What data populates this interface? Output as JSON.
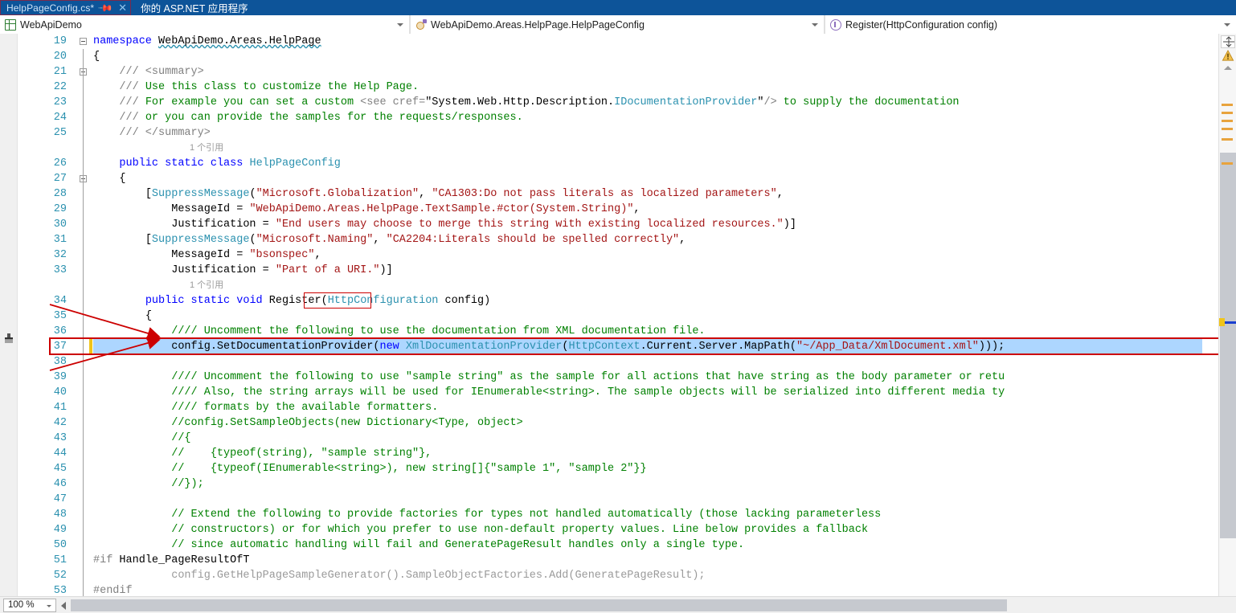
{
  "window": {
    "app_caption": "你的 ASP.NET 应用程序"
  },
  "tab": {
    "title": "HelpPageConfig.cs*",
    "pin_icon": "pin-icon",
    "close_icon": "close-icon"
  },
  "navbar": {
    "project": {
      "label": "WebApiDemo",
      "icon": "project-icon"
    },
    "type": {
      "label": "WebApiDemo.Areas.HelpPage.HelpPageConfig",
      "icon": "class-icon"
    },
    "member": {
      "label": "Register(HttpConfiguration config)",
      "icon": "method-icon"
    }
  },
  "editor": {
    "first_line": 19,
    "codelens_label": "1 个引用",
    "selected_line": 37,
    "lines": [
      {
        "n": 19,
        "html": "<span class=\"kw\">namespace</span> <span class=\"pln squiggle\">WebApiDemo.Areas.HelpPage</span>"
      },
      {
        "n": 20,
        "html": "<span class=\"pln\">{</span>"
      },
      {
        "n": 21,
        "html": "    <span class=\"doctag\">/// &lt;summary&gt;</span>"
      },
      {
        "n": 22,
        "html": "    <span class=\"doctag\">///</span> <span class=\"doc\">Use this class to customize the Help Page.</span>"
      },
      {
        "n": 23,
        "html": "    <span class=\"doctag\">///</span> <span class=\"doc\">For example you can set a custom </span><span class=\"doctag\">&lt;see cref=</span><span class=\"pln\">\"System.Web.Http.Description.</span><span class=\"typ\">IDocumentationProvider</span><span class=\"pln\">\"</span><span class=\"doctag\">/&gt;</span><span class=\"doc\"> to supply the documentation</span>"
      },
      {
        "n": 24,
        "html": "    <span class=\"doctag\">///</span> <span class=\"doc\">or you can provide the samples for the requests/responses.</span>"
      },
      {
        "n": 25,
        "html": "    <span class=\"doctag\">/// &lt;/summary&gt;</span>"
      },
      {
        "n": 26,
        "html": "    <span class=\"kw\">public</span> <span class=\"kw\">static</span> <span class=\"kw\">class</span> <span class=\"typ\">HelpPageConfig</span>"
      },
      {
        "n": 27,
        "html": "    <span class=\"pln\">{</span>"
      },
      {
        "n": 28,
        "html": "        <span class=\"pln\">[</span><span class=\"typ\">SuppressMessage</span><span class=\"pln\">(</span><span class=\"str\">\"Microsoft.Globalization\"</span><span class=\"pln\">, </span><span class=\"str\">\"CA1303:Do not pass literals as localized parameters\"</span><span class=\"pln\">,</span>"
      },
      {
        "n": 29,
        "html": "            <span class=\"pln\">MessageId = </span><span class=\"str\">\"WebApiDemo.Areas.HelpPage.TextSample.#ctor(System.String)\"</span><span class=\"pln\">,</span>"
      },
      {
        "n": 30,
        "html": "            <span class=\"pln\">Justification = </span><span class=\"str\">\"End users may choose to merge this string with existing localized resources.\"</span><span class=\"pln\">)]</span>"
      },
      {
        "n": 31,
        "html": "        <span class=\"pln\">[</span><span class=\"typ\">SuppressMessage</span><span class=\"pln\">(</span><span class=\"str\">\"Microsoft.Naming\"</span><span class=\"pln\">, </span><span class=\"str\">\"CA2204:Literals should be spelled correctly\"</span><span class=\"pln\">,</span>"
      },
      {
        "n": 32,
        "html": "            <span class=\"pln\">MessageId = </span><span class=\"str\">\"bsonspec\"</span><span class=\"pln\">,</span>"
      },
      {
        "n": 33,
        "html": "            <span class=\"pln\">Justification = </span><span class=\"str\">\"Part of a URI.\"</span><span class=\"pln\">)]</span>"
      },
      {
        "n": 34,
        "html": "        <span class=\"kw\">public</span> <span class=\"kw\">static</span> <span class=\"kw\">void</span> <span class=\"pln\">Register(</span><span class=\"typ\">HttpConfiguration</span> <span class=\"pln\">config)</span>"
      },
      {
        "n": 35,
        "html": "        <span class=\"pln\">{</span>"
      },
      {
        "n": 36,
        "html": "            <span class=\"cmt\">//// Uncomment the following to use the documentation from XML documentation file.</span>"
      },
      {
        "n": 37,
        "html": "            <span class=\"pln\">config.SetDocumentationProvider(</span><span class=\"kw\">new</span> <span class=\"typ\">XmlDocumentationProvider</span><span class=\"pln\">(</span><span class=\"typ\">HttpContext</span><span class=\"pln\">.Current.Server.MapPath(</span><span class=\"str\">\"~/App_Data/XmlDocument.xml\"</span><span class=\"pln\">)));</span>"
      },
      {
        "n": 38,
        "html": ""
      },
      {
        "n": 39,
        "html": "            <span class=\"cmt\">//// Uncomment the following to use \"sample string\" as the sample for all actions that have string as the body parameter or retu</span>"
      },
      {
        "n": 40,
        "html": "            <span class=\"cmt\">//// Also, the string arrays will be used for IEnumerable&lt;string&gt;. The sample objects will be serialized into different media ty</span>"
      },
      {
        "n": 41,
        "html": "            <span class=\"cmt\">//// formats by the available formatters.</span>"
      },
      {
        "n": 42,
        "html": "            <span class=\"cmt\">//config.SetSampleObjects(new Dictionary&lt;Type, object&gt;</span>"
      },
      {
        "n": 43,
        "html": "            <span class=\"cmt\">//{</span>"
      },
      {
        "n": 44,
        "html": "            <span class=\"cmt\">//    {typeof(string), \"sample string\"},</span>"
      },
      {
        "n": 45,
        "html": "            <span class=\"cmt\">//    {typeof(IEnumerable&lt;string&gt;), new string[]{\"sample 1\", \"sample 2\"}}</span>"
      },
      {
        "n": 46,
        "html": "            <span class=\"cmt\">//});</span>"
      },
      {
        "n": 47,
        "html": ""
      },
      {
        "n": 48,
        "html": "            <span class=\"cmt\">// Extend the following to provide factories for types not handled automatically (those lacking parameterless</span>"
      },
      {
        "n": 49,
        "html": "            <span class=\"cmt\">// constructors) or for which you prefer to use non-default property values. Line below provides a fallback</span>"
      },
      {
        "n": 50,
        "html": "            <span class=\"cmt\">// since automatic handling will fail and GeneratePageResult handles only a single type.</span>"
      },
      {
        "n": 51,
        "html": "<span class=\"prep\">#if</span> <span class=\"pln\">Handle_PageResultOfT</span>"
      },
      {
        "n": 52,
        "html": "            <span class=\"gray\">config.GetHelpPageSampleGenerator().SampleObjectFactories.Add(GeneratePageResult);</span>"
      },
      {
        "n": 53,
        "html": "<span class=\"prep\">#endif</span>"
      }
    ],
    "line_37_text": "config.SetDocumentationProvider(new XmlDocumentationProvider(HttpContext.Current.Server.MapPath(\"~/App_Data/XmlDocument.xml\")));",
    "highlighted_identifier": "Register"
  },
  "right_margin": {
    "split_icon": "split-view-icon",
    "warning_icon": "warning-triangle-icon",
    "collapse_icon": "chevron-up-icon"
  },
  "statusbar": {
    "zoom": "100 %"
  },
  "colors": {
    "tab_blue": "#0d5499",
    "keyword": "#0000ff",
    "type": "#2b91af",
    "string": "#a31515",
    "comment": "#008000",
    "selection": "#add6ff",
    "annotation_red": "#cc0000",
    "marker_orange": "#e8a33d",
    "current_line_marker": "#1a3fd0",
    "changebar_yellow": "#f0c419"
  }
}
